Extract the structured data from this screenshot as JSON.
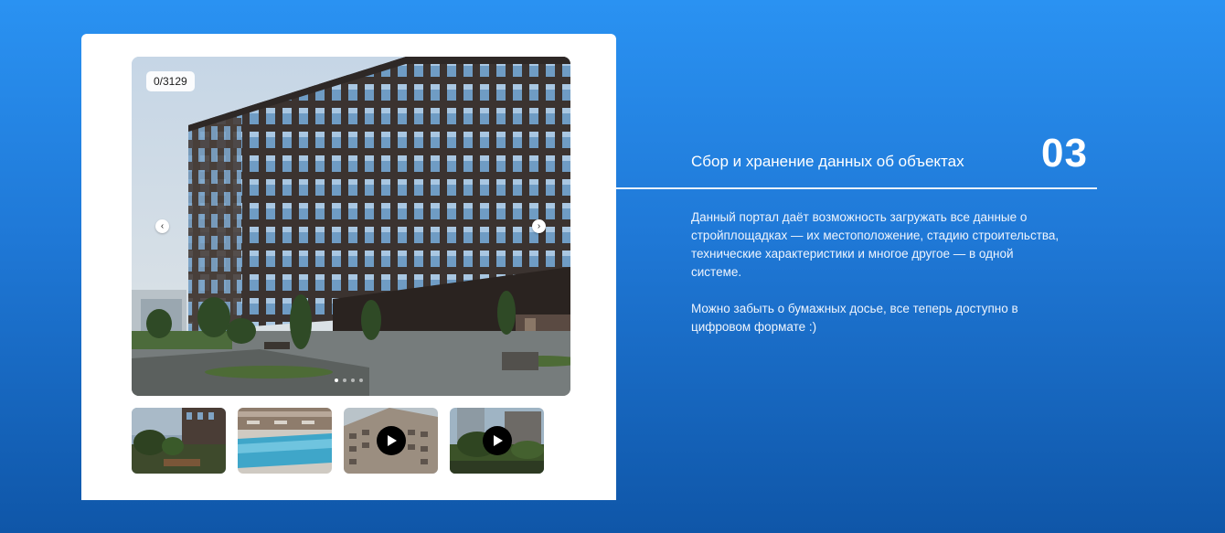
{
  "gallery": {
    "counter": "0/3129",
    "prev_icon": "chevron-left-icon",
    "next_icon": "chevron-right-icon",
    "prev_glyph": "‹",
    "next_glyph": "›",
    "dots_total": 4,
    "dots_active_index": 0,
    "thumbnails": [
      {
        "name": "courtyard-photo",
        "video": false
      },
      {
        "name": "pool-photo",
        "video": false
      },
      {
        "name": "building-video",
        "video": true
      },
      {
        "name": "park-video",
        "video": true
      }
    ]
  },
  "feature": {
    "number": "03",
    "title": "Сбор и хранение данных об объектах",
    "paragraph_1": "Данный портал даёт возможность загружать все данные о стройплощадках — их местоположение, стадию строительства, технические характеристики и многое другое — в одной системе.",
    "paragraph_2": "Можно забыть о бумажных досье, все теперь доступно в цифровом формате :)"
  },
  "colors": {
    "background_top": "#2a92f2",
    "background_bottom": "#0f56a8",
    "card": "#ffffff",
    "text": "#ffffff"
  }
}
